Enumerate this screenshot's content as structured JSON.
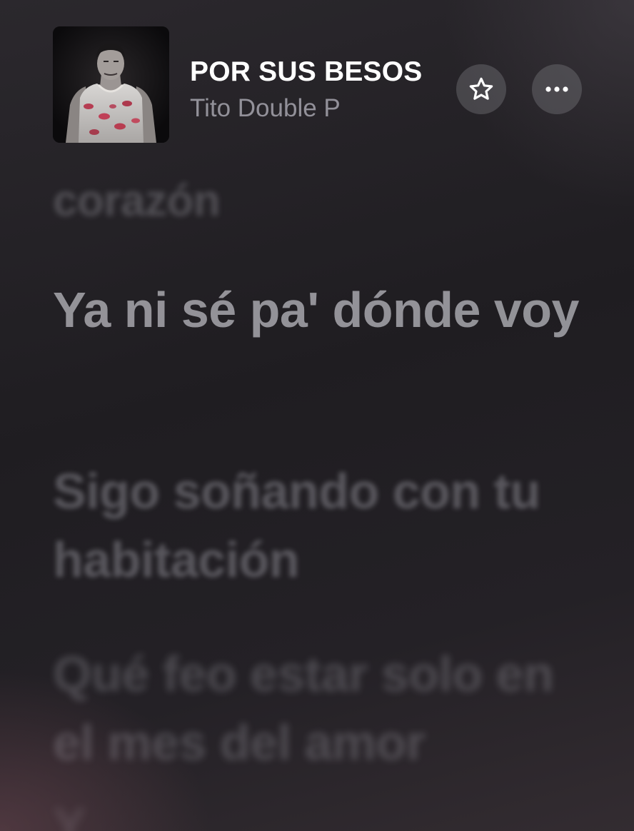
{
  "header": {
    "song_title": "POR SUS BESOS",
    "artist": "Tito Double P",
    "favorite_icon": "star-icon",
    "more_icon": "ellipsis-icon"
  },
  "lyrics": {
    "previous": "corazón",
    "current": "Ya ni sé pa' dónde voy",
    "upcoming": [
      "Sigo soñando con tu habitación",
      "Qué feo estar solo en el mes del amor",
      "Y"
    ]
  },
  "colors": {
    "background": "#232126",
    "title": "#ffffff",
    "artist": "#8e8d93",
    "button_bg": "#4a484e"
  }
}
